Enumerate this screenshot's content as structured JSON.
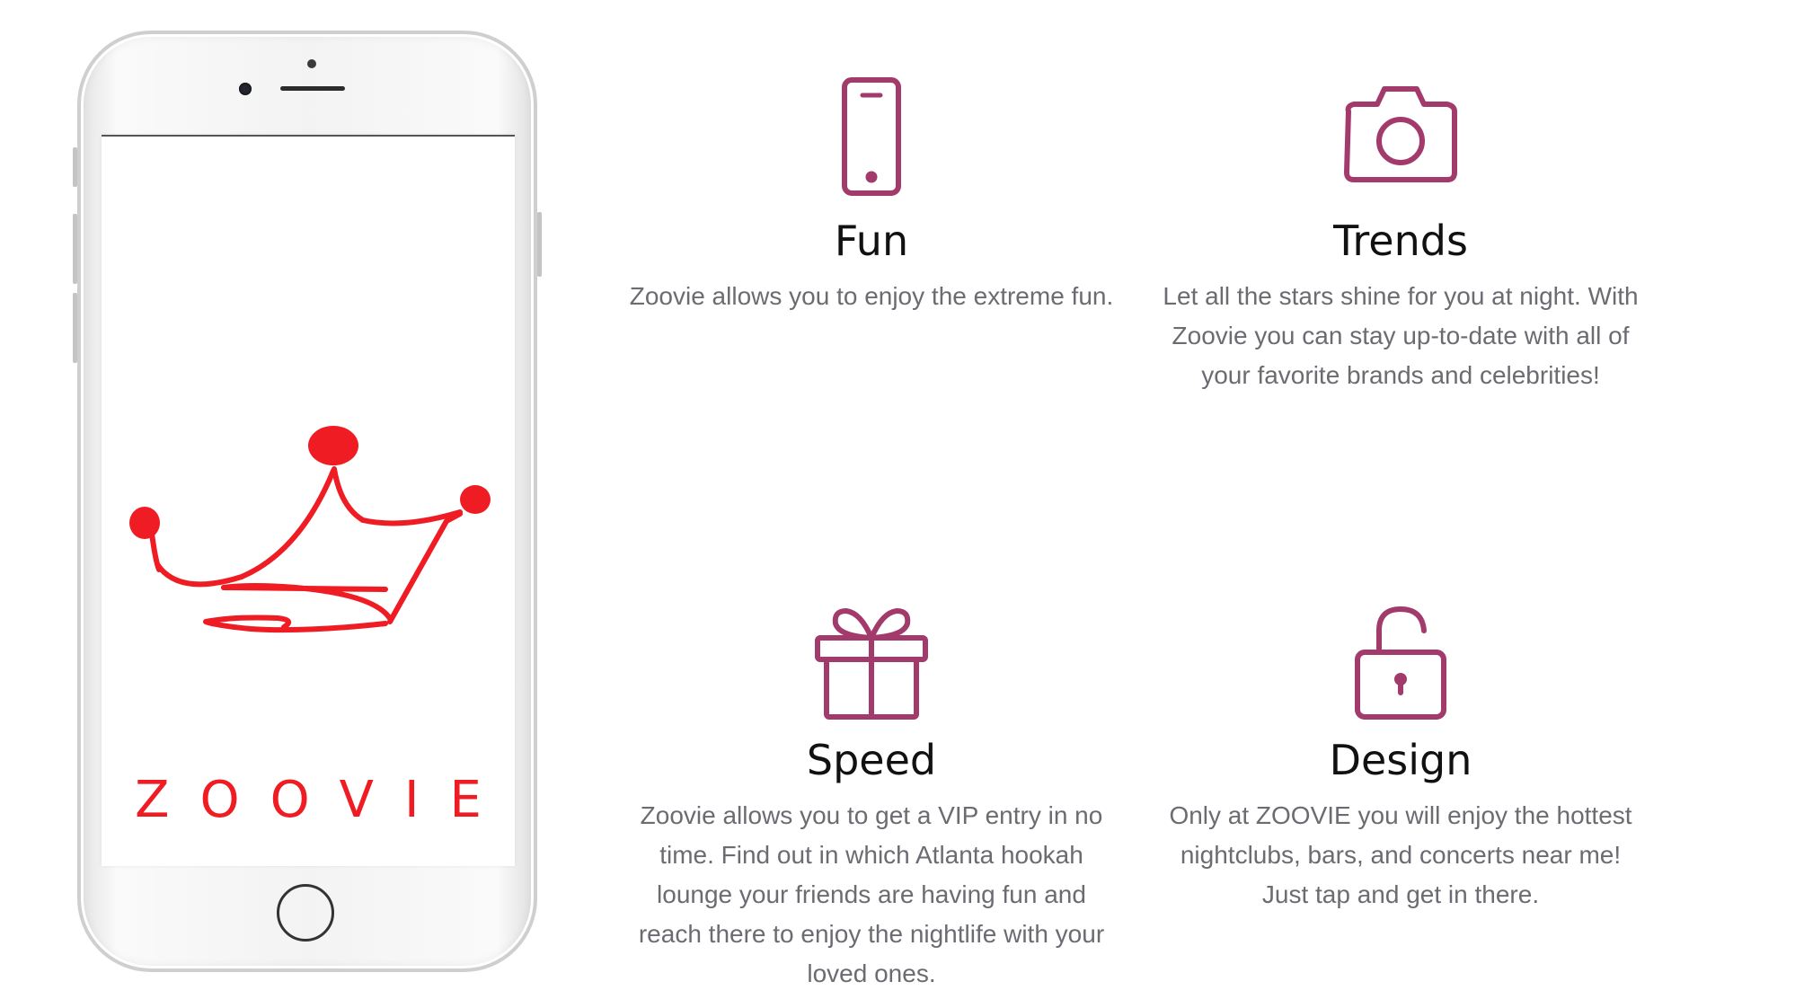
{
  "brand": {
    "name": "ZOOVIE",
    "color": "#ef1c24"
  },
  "accent_color": "#a23a6b",
  "features": [
    {
      "icon": "smartphone-icon",
      "title": "Fun",
      "text": "Zoovie allows you to enjoy the extreme fun."
    },
    {
      "icon": "camera-icon",
      "title": "Trends",
      "text": "Let all the stars shine for you at night. With Zoovie you can stay up-to-date with all of your favorite brands and celebrities!"
    },
    {
      "icon": "gift-icon",
      "title": "Speed",
      "text": "Zoovie allows you to get a VIP entry in no time. Find out in which Atlanta hookah lounge your friends are having fun and reach there to enjoy the nightlife with your loved ones."
    },
    {
      "icon": "unlock-icon",
      "title": "Design",
      "text": "Only at ZOOVIE you will enjoy the hottest nightclubs, bars, and concerts near me! Just tap and get in there."
    }
  ]
}
